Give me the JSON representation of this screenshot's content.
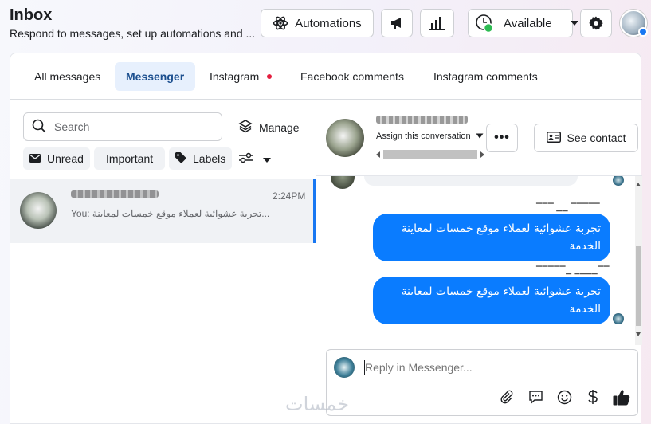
{
  "header": {
    "title": "Inbox",
    "subtitle": "Respond to messages, set up automations and ...",
    "automations_label": "Automations",
    "status_label": "Available"
  },
  "tabs": [
    {
      "label": "All messages"
    },
    {
      "label": "Messenger"
    },
    {
      "label": "Instagram"
    },
    {
      "label": "Facebook comments"
    },
    {
      "label": "Instagram comments"
    }
  ],
  "left": {
    "search_placeholder": "Search",
    "manage_label": "Manage",
    "chips": [
      "Unread",
      "Important",
      "Labels"
    ],
    "conversation": {
      "time": "2:24PM",
      "snippet": "You: تجربة عشوائية لعملاء موقع خمسات لمعاينة..."
    }
  },
  "chat": {
    "assign_label": "Assign this conversation",
    "more_label": "•••",
    "see_contact_label": "See contact",
    "messages": [
      {
        "text": "تجربة عشوائية لعملاء موقع خمسات لمعاينة الخدمة"
      },
      {
        "text": "تجربة عشوائية لعملاء موقع خمسات لمعاينة الخدمة"
      }
    ],
    "reply_placeholder": "Reply in Messenger..."
  },
  "watermark": "خمسات",
  "colors": {
    "accent": "#1877f2",
    "bubble": "#0a7cff",
    "status_green": "#2dbb52",
    "notification_dot": "#e41e3f"
  }
}
